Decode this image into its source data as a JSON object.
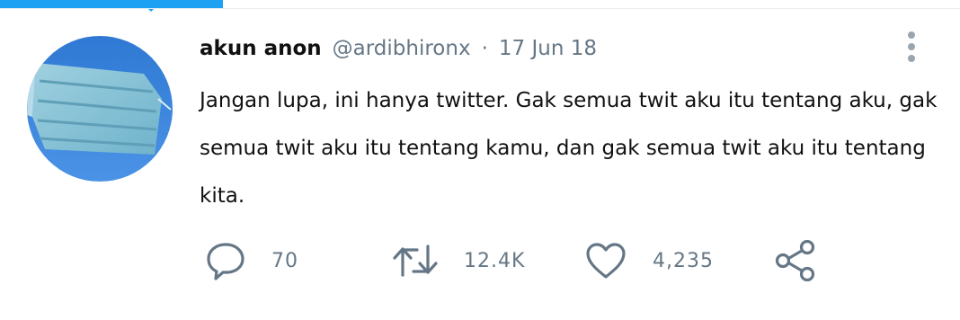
{
  "tweet": {
    "author": {
      "display_name": "akun anon",
      "handle": "@ardibhironx"
    },
    "separator": "·",
    "date": "17 Jun 18",
    "text": "Jangan lupa, ini hanya twitter. Gak semua twit aku itu tentang aku, gak semua twit aku itu tentang kamu, dan gak semua twit aku itu tentang kita.",
    "stats": {
      "replies": "70",
      "retweets": "12.4K",
      "likes": "4,235"
    }
  },
  "icons": {
    "reply": "speech-bubble-icon",
    "retweet": "retweet-arrows-icon",
    "like": "heart-icon",
    "share": "share-nodes-icon",
    "more": "vertical-dots-icon"
  },
  "colors": {
    "accent": "#1da1f2",
    "secondary_text": "#657786",
    "icon": "#657786",
    "primary_text": "#111111"
  }
}
